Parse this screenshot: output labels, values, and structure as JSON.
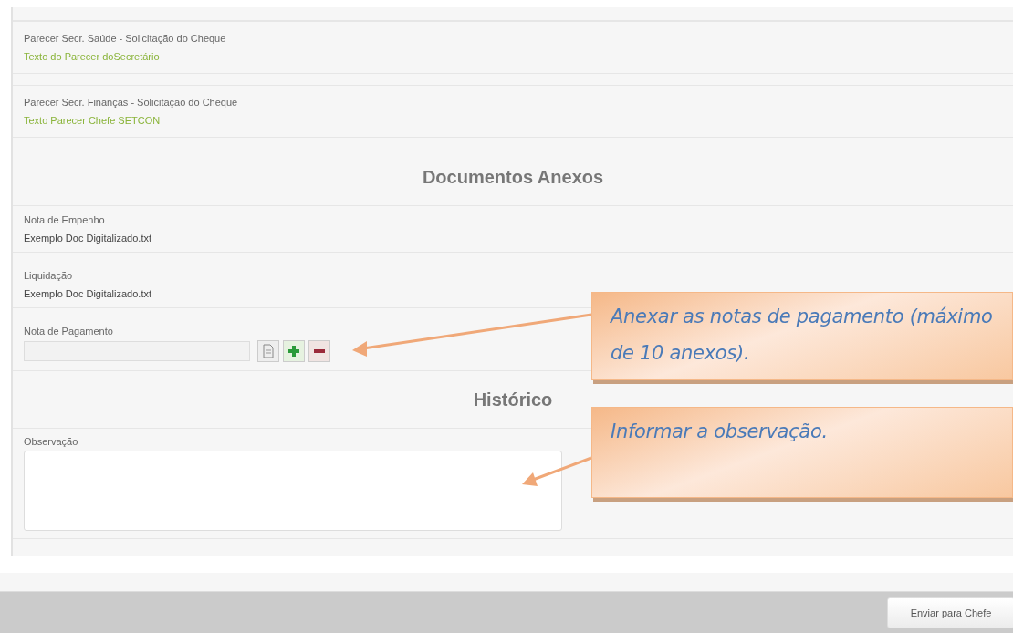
{
  "rows": [
    {
      "kind": "opinion",
      "label": "Parecer Secr. Saúde - Solicitação do Cheque",
      "value": "Texto do Parecer doSecretário"
    },
    {
      "kind": "opinion",
      "label": "Parecer Secr. Finanças - Solicitação do Cheque",
      "value": "Texto Parecer Chefe SETCON"
    },
    {
      "kind": "heading",
      "label": "Documentos Anexos"
    },
    {
      "kind": "file",
      "label": "Nota de Empenho",
      "value": "Exemplo Doc Digitalizado.txt"
    },
    {
      "kind": "file",
      "label": "Liquidação",
      "value": "Exemplo Doc Digitalizado.txt"
    },
    {
      "kind": "upload",
      "label": "Nota de Pagamento"
    },
    {
      "kind": "heading",
      "label": "Histórico"
    },
    {
      "kind": "textarea",
      "label": "Observação"
    }
  ],
  "callouts": [
    {
      "text": "Anexar as notas de pagamento (máximo de 10 anexos)."
    },
    {
      "text": "Informar a observação."
    }
  ],
  "footer": {
    "button": "Enviar para Chefe"
  }
}
